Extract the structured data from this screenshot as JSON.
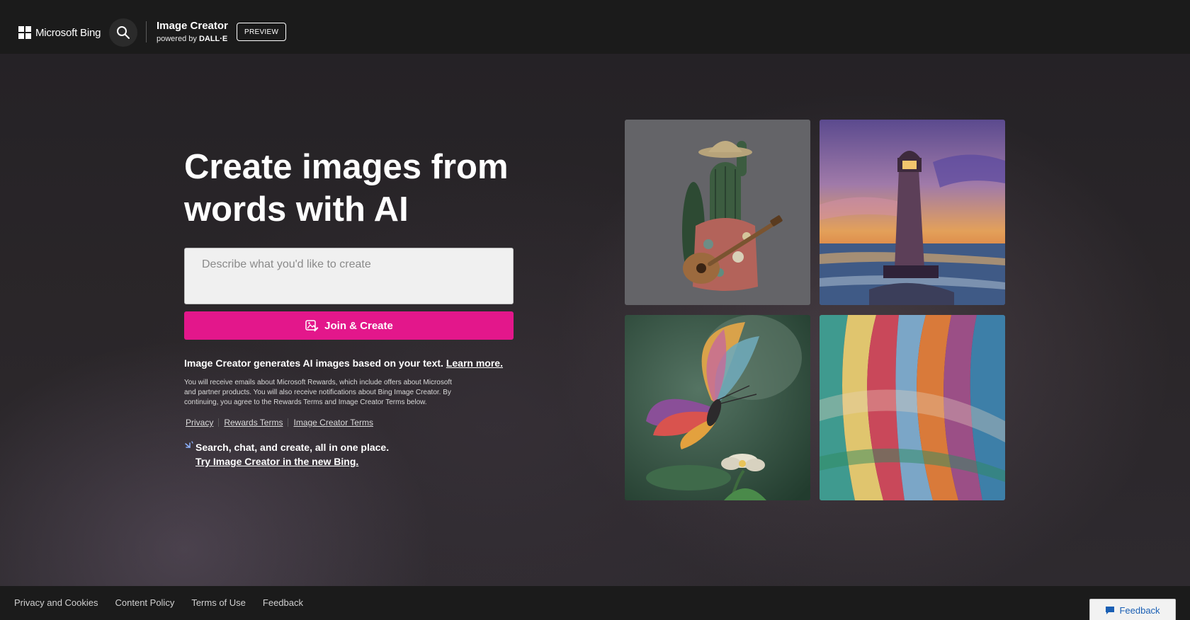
{
  "header": {
    "brand": "Microsoft Bing",
    "product_title": "Image Creator",
    "powered_prefix": "powered by",
    "powered_brand": "DALL·E",
    "preview_label": "PREVIEW"
  },
  "hero": {
    "title": "Create images from words with AI",
    "prompt_placeholder": "Describe what you'd like to create",
    "create_label": "Join & Create",
    "desc_text": "Image Creator generates AI images based on your text.",
    "learn_more": "Learn more.",
    "fine_print": "You will receive emails about Microsoft Rewards, which include offers about Microsoft and partner products. You will also receive notifications about Bing Image Creator. By continuing, you agree to the Rewards Terms and Image Creator Terms below.",
    "terms": [
      "Privacy",
      "Rewards Terms",
      "Image Creator Terms"
    ],
    "promo_line": "Search, chat, and create, all in one place.",
    "promo_link": "Try Image Creator in the new Bing."
  },
  "gallery": {
    "images": [
      "cactus-guitar-image",
      "lighthouse-sunset-image",
      "rainbow-butterfly-image",
      "colorful-ribbons-image"
    ]
  },
  "footer": {
    "links": [
      "Privacy and Cookies",
      "Content Policy",
      "Terms of Use",
      "Feedback"
    ],
    "feedback_button": "Feedback"
  },
  "colors": {
    "accent": "#e3178b",
    "header_bg": "#1b1b1b",
    "link_blue": "#1a5fb4"
  }
}
